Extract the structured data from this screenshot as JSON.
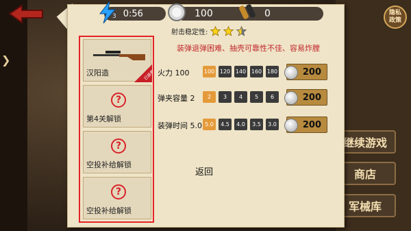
{
  "privacy": {
    "label_top": "隐私",
    "label_bottom": "政策"
  },
  "stats": {
    "energy_level": "3",
    "timer": "0:56",
    "silver": "100",
    "bullets": "0"
  },
  "stability": {
    "label": "射击稳定性:",
    "stars": 2.5
  },
  "description": "装弹退弹困难、抽壳可靠性不佳、容易炸膛",
  "weapons": [
    {
      "label": "汉阳造",
      "badge": "已装备"
    },
    {
      "label": "第4关解锁"
    },
    {
      "label": "空投补给解锁"
    },
    {
      "label": "空投补给解锁"
    }
  ],
  "attributes": [
    {
      "label": "火力 100",
      "levels": [
        "100",
        "120",
        "140",
        "160",
        "180"
      ],
      "active": 0,
      "cost": "200"
    },
    {
      "label": "弹夹容量 2",
      "levels": [
        "2",
        "3",
        "4",
        "5",
        "6"
      ],
      "active": 0,
      "cost": "200"
    },
    {
      "label": "装弹时间 5.0",
      "levels": [
        "5.0",
        "4.5",
        "4.0",
        "3.5",
        "3.0"
      ],
      "active": 0,
      "cost": "200"
    }
  ],
  "return_label": "返回",
  "side_menu": [
    "继续游戏",
    "商店",
    "军械库"
  ],
  "colors": {
    "highlight": "#e52228",
    "active_level": "#e59a3a",
    "desc_red": "#c1272d"
  }
}
